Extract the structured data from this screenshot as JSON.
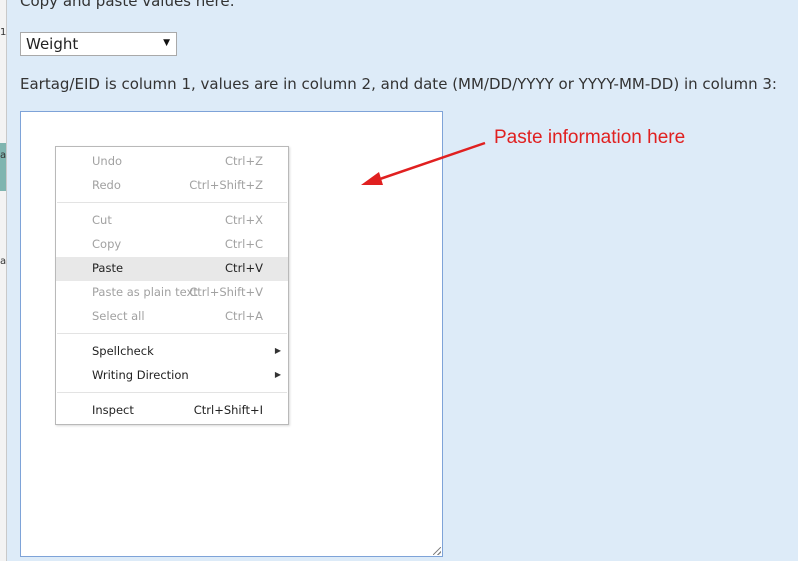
{
  "page": {
    "instruction_top": "Copy and paste values here:",
    "instruction_columns": "Eartag/EID is column 1, values are in column 2, and date (MM/DD/YYYY or YYYY-MM-DD) in column 3:",
    "annotation": "Paste information here",
    "annotation_color": "#e02020"
  },
  "left_strip": {
    "fragments": [
      "1",
      "a",
      "a"
    ]
  },
  "select": {
    "value": "Weight",
    "caret": "▼"
  },
  "textarea": {
    "value": ""
  },
  "context_menu": {
    "items": [
      {
        "label": "Undo",
        "shortcut": "Ctrl+Z",
        "enabled": false
      },
      {
        "label": "Redo",
        "shortcut": "Ctrl+Shift+Z",
        "enabled": false
      },
      {
        "label": "Cut",
        "shortcut": "Ctrl+X",
        "enabled": false
      },
      {
        "label": "Copy",
        "shortcut": "Ctrl+C",
        "enabled": false
      },
      {
        "label": "Paste",
        "shortcut": "Ctrl+V",
        "enabled": true,
        "highlighted": true
      },
      {
        "label": "Paste as plain text",
        "shortcut": "Ctrl+Shift+V",
        "enabled": false
      },
      {
        "label": "Select all",
        "shortcut": "Ctrl+A",
        "enabled": false
      },
      {
        "label": "Spellcheck",
        "shortcut": "",
        "enabled": true,
        "submenu": true
      },
      {
        "label": "Writing Direction",
        "shortcut": "",
        "enabled": true,
        "submenu": true
      },
      {
        "label": "Inspect",
        "shortcut": "Ctrl+Shift+I",
        "enabled": true
      }
    ],
    "submenu_icon": "▶"
  }
}
